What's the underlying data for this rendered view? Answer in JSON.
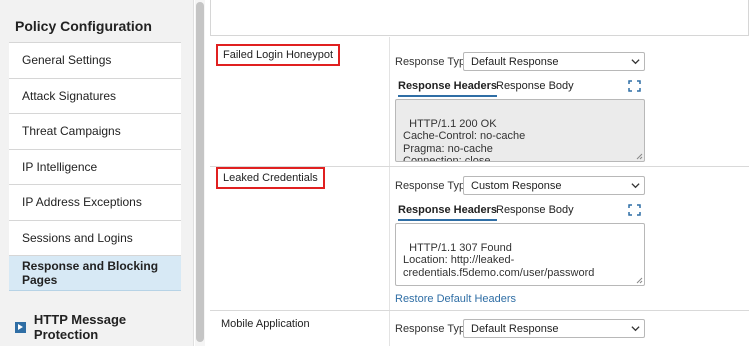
{
  "sidebar": {
    "title": "Policy Configuration",
    "items": [
      {
        "label": "General Settings"
      },
      {
        "label": "Attack Signatures"
      },
      {
        "label": "Threat Campaigns"
      },
      {
        "label": "IP Intelligence"
      },
      {
        "label": "IP Address Exceptions"
      },
      {
        "label": "Sessions and Logins"
      },
      {
        "label": "Response and Blocking Pages"
      }
    ],
    "section": {
      "label": "HTTP Message Protection"
    }
  },
  "rows": [
    {
      "label": "Failed Login Honeypot",
      "response_type_label": "Response Type",
      "response_type_value": "Default Response",
      "tabs": [
        "Response Headers",
        "Response Body"
      ],
      "headers": "HTTP/1.1 200 OK\nCache-Control: no-cache\nPragma: no-cache\nConnection: close"
    },
    {
      "label": "Leaked Credentials",
      "response_type_label": "Response Type",
      "response_type_value": "Custom Response",
      "tabs": [
        "Response Headers",
        "Response Body"
      ],
      "headers": "HTTP/1.1 307 Found\nLocation: http://leaked-\ncredentials.f5demo.com/user/password",
      "restore_link": "Restore Default Headers"
    },
    {
      "label": "Mobile Application",
      "response_type_label": "Response Type",
      "response_type_value": "Default Response"
    }
  ],
  "colors": {
    "accent": "#2f6ea5",
    "highlight_border": "#e02020",
    "active_item_bg": "#d7e9f5"
  }
}
